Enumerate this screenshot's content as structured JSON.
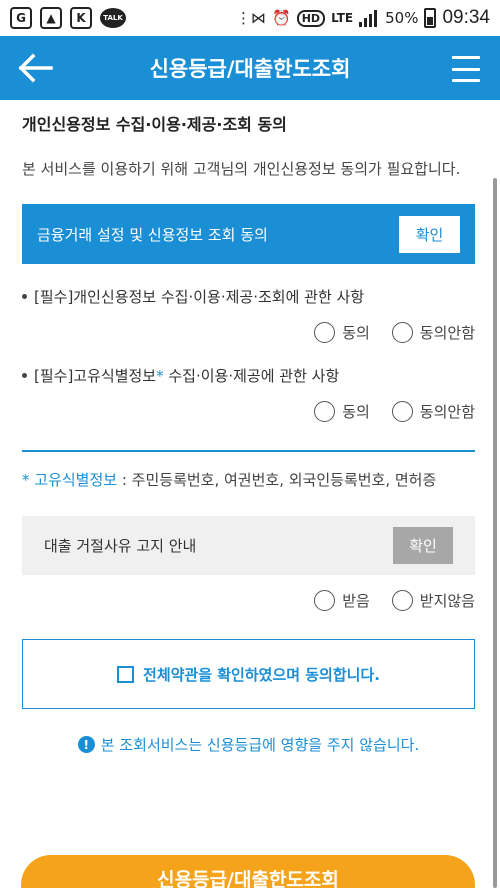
{
  "status_bar": {
    "left_icons": [
      "sync-icon",
      "gallery-icon",
      "kakao-icon",
      "talk-icon"
    ],
    "talk_label": "TALK",
    "hd": "HD",
    "lte": "LTE",
    "battery": "50%",
    "time": "09:34"
  },
  "header": {
    "title": "신용등급/대출한도조회",
    "back_icon": "arrow-left-icon",
    "menu_icon": "hamburger-menu-icon",
    "color": "#1a8fd6"
  },
  "section": {
    "title": "개인신용정보 수집·이용·제공·조회 동의",
    "description": "본 서비스를 이용하기 위해 고객님의 개인신용정보 동의가 필요합니다."
  },
  "consent_bar": {
    "label": "금융거래 설정 및 신용정보 조회 동의",
    "button": "확인"
  },
  "items": [
    {
      "title_prefix": "[필수]개인신용정보 수집·이용·제공·조회에 관한 사항",
      "option_agree": "동의",
      "option_disagree": "동의안함"
    },
    {
      "title_prefix": "[필수]고유식별정보",
      "title_star": "*",
      "title_suffix": " 수집·이용·제공에 관한 사항",
      "option_agree": "동의",
      "option_disagree": "동의안함"
    }
  ],
  "note": {
    "label": "* 고유식별정보",
    "text": " : 주민등록번호, 여권번호, 외국인등록번호, 면허증"
  },
  "refusal_bar": {
    "label": "대출 거절사유 고지 안내",
    "button": "확인",
    "option_receive": "받음",
    "option_not_receive": "받지않음"
  },
  "agree_all": {
    "label": "전체약관을 확인하였으며 동의합니다."
  },
  "info": {
    "icon": "exclamation-circle-icon",
    "text": "본 조회서비스는 신용등급에 영향을 주지 않습니다."
  },
  "cta": {
    "label": "신용등급/대출한도조회",
    "color": "#f5a31a"
  }
}
